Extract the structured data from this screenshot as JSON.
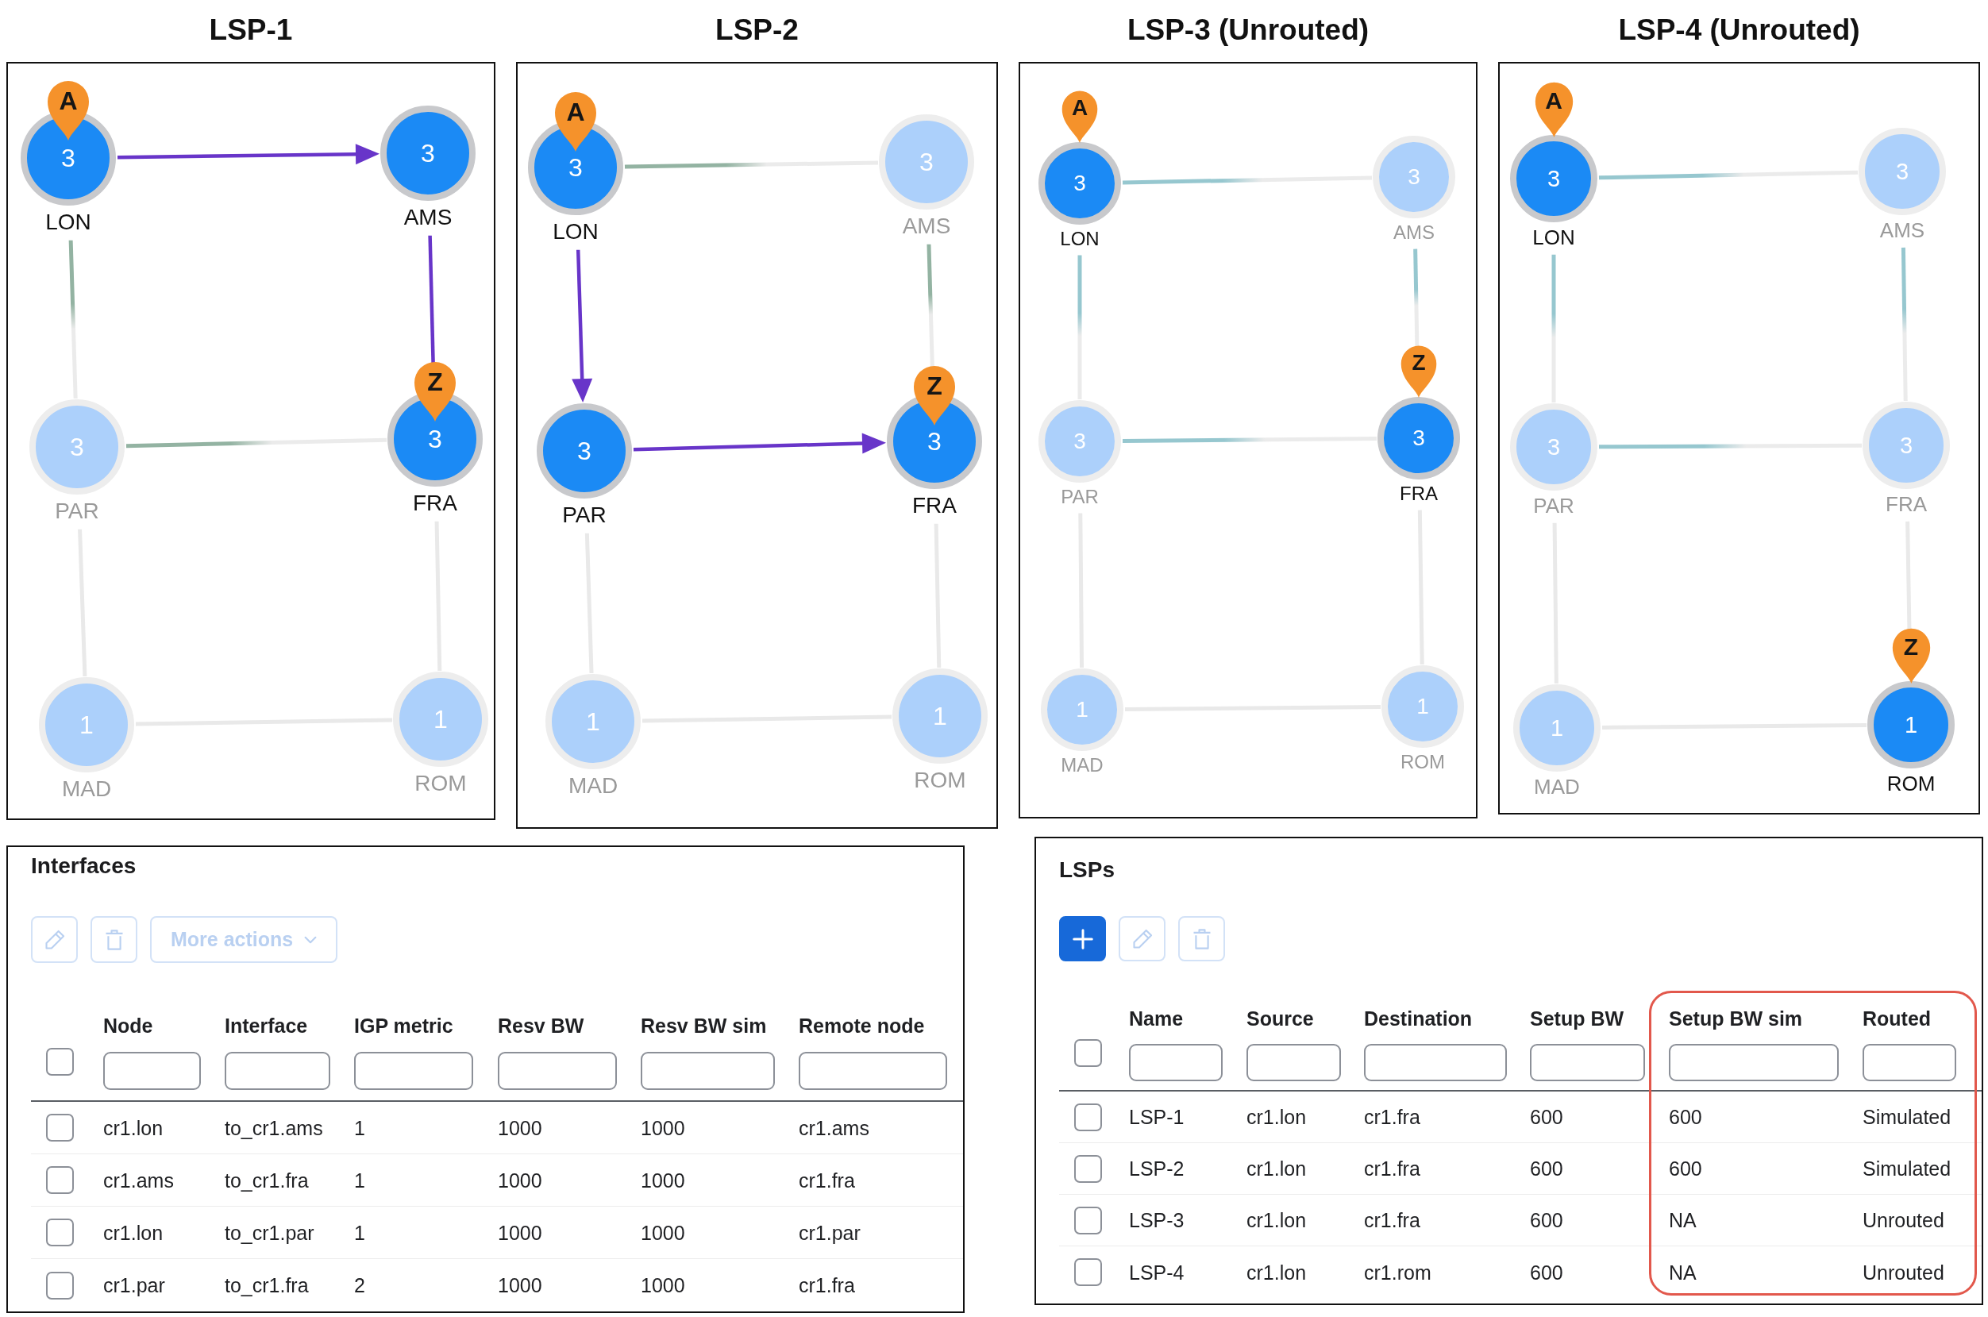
{
  "panels": [
    {
      "title": "LSP-1",
      "node_rows": [
        [
          {
            "label": "LON",
            "count": "3",
            "active": true,
            "pin": "A"
          },
          {
            "label": "AMS",
            "count": "3",
            "active": true
          }
        ],
        [
          {
            "label": "PAR",
            "count": "3",
            "active": false
          },
          {
            "label": "FRA",
            "count": "3",
            "active": true,
            "pin": "Z"
          }
        ],
        [
          {
            "label": "MAD",
            "count": "1",
            "active": false
          },
          {
            "label": "ROM",
            "count": "1",
            "active": false
          }
        ]
      ],
      "links": [
        {
          "kind": "path"
        },
        {
          "kind": "gradient",
          "color": "#93b3a2"
        },
        {
          "kind": "path"
        },
        {
          "kind": "gradient",
          "color": "#93b3a2"
        },
        {
          "kind": "plain"
        },
        {
          "kind": "plain"
        },
        {
          "kind": "plain"
        }
      ]
    },
    {
      "title": "LSP-2",
      "node_rows": [
        [
          {
            "label": "LON",
            "count": "3",
            "active": true,
            "pin": "A"
          },
          {
            "label": "AMS",
            "count": "3",
            "active": false
          }
        ],
        [
          {
            "label": "PAR",
            "count": "3",
            "active": true
          },
          {
            "label": "FRA",
            "count": "3",
            "active": true,
            "pin": "Z"
          }
        ],
        [
          {
            "label": "MAD",
            "count": "1",
            "active": false
          },
          {
            "label": "ROM",
            "count": "1",
            "active": false
          }
        ]
      ],
      "links": [
        {
          "kind": "gradient",
          "color": "#93b3a2"
        },
        {
          "kind": "path"
        },
        {
          "kind": "gradient",
          "color": "#93b3a2"
        },
        {
          "kind": "path"
        },
        {
          "kind": "plain"
        },
        {
          "kind": "plain"
        },
        {
          "kind": "plain"
        }
      ]
    },
    {
      "title": "LSP-3 (Unrouted)",
      "node_rows": [
        [
          {
            "label": "LON",
            "count": "3",
            "active": true,
            "pin": "A"
          },
          {
            "label": "AMS",
            "count": "3",
            "active": false
          }
        ],
        [
          {
            "label": "PAR",
            "count": "3",
            "active": false
          },
          {
            "label": "FRA",
            "count": "3",
            "active": true,
            "pin": "Z"
          }
        ],
        [
          {
            "label": "MAD",
            "count": "1",
            "active": false
          },
          {
            "label": "ROM",
            "count": "1",
            "active": false
          }
        ]
      ],
      "links": [
        {
          "kind": "gradient",
          "color": "#96c7cf"
        },
        {
          "kind": "gradient",
          "color": "#96c7cf"
        },
        {
          "kind": "gradient",
          "color": "#96c7cf"
        },
        {
          "kind": "gradient",
          "color": "#96c7cf"
        },
        {
          "kind": "plain"
        },
        {
          "kind": "plain"
        },
        {
          "kind": "plain"
        }
      ]
    },
    {
      "title": "LSP-4 (Unrouted)",
      "node_rows": [
        [
          {
            "label": "LON",
            "count": "3",
            "active": true,
            "pin": "A"
          },
          {
            "label": "AMS",
            "count": "3",
            "active": false
          }
        ],
        [
          {
            "label": "PAR",
            "count": "3",
            "active": false
          },
          {
            "label": "FRA",
            "count": "3",
            "active": false
          }
        ],
        [
          {
            "label": "MAD",
            "count": "1",
            "active": false
          },
          {
            "label": "ROM",
            "count": "1",
            "active": true,
            "pin": "Z"
          }
        ]
      ],
      "links": [
        {
          "kind": "gradient",
          "color": "#96c7cf"
        },
        {
          "kind": "gradient",
          "color": "#96c7cf"
        },
        {
          "kind": "gradient",
          "color": "#96c7cf"
        },
        {
          "kind": "gradient",
          "color": "#96c7cf"
        },
        {
          "kind": "plain"
        },
        {
          "kind": "plain"
        },
        {
          "kind": "plain"
        }
      ]
    }
  ],
  "tables": [
    {
      "title": "Interfaces",
      "toolbar": [
        {
          "kind": "edit",
          "disabled": true
        },
        {
          "kind": "delete",
          "disabled": true
        },
        {
          "kind": "menu",
          "label": "More actions",
          "disabled": true
        }
      ],
      "select_all": {
        "checked": false
      },
      "columns": [
        {
          "label": "Node"
        },
        {
          "label": "Interface"
        },
        {
          "label": "IGP metric"
        },
        {
          "label": "Resv BW"
        },
        {
          "label": "Resv BW sim"
        },
        {
          "label": "Remote node"
        }
      ],
      "rows": [
        {
          "checked": false,
          "cells": [
            "cr1.lon",
            "to_cr1.ams",
            "1",
            "1000",
            "1000",
            "cr1.ams"
          ]
        },
        {
          "checked": false,
          "cells": [
            "cr1.ams",
            "to_cr1.fra",
            "1",
            "1000",
            "1000",
            "cr1.fra"
          ]
        },
        {
          "checked": false,
          "cells": [
            "cr1.lon",
            "to_cr1.par",
            "1",
            "1000",
            "1000",
            "cr1.par"
          ]
        },
        {
          "checked": false,
          "cells": [
            "cr1.par",
            "to_cr1.fra",
            "2",
            "1000",
            "1000",
            "cr1.fra"
          ]
        }
      ]
    },
    {
      "title": "LSPs",
      "toolbar": [
        {
          "kind": "add",
          "disabled": false
        },
        {
          "kind": "edit",
          "disabled": true
        },
        {
          "kind": "delete",
          "disabled": true
        }
      ],
      "select_all": {
        "checked": false
      },
      "columns": [
        {
          "label": "Name",
          "highlighted": false
        },
        {
          "label": "Source",
          "highlighted": false
        },
        {
          "label": "Destination",
          "highlighted": false
        },
        {
          "label": "Setup BW",
          "highlighted": false
        },
        {
          "label": "Setup BW sim",
          "highlighted": true
        },
        {
          "label": "Routed",
          "highlighted": true
        }
      ],
      "rows": [
        {
          "checked": false,
          "cells": [
            "LSP-1",
            "cr1.lon",
            "cr1.fra",
            "600",
            "600",
            "Simulated"
          ]
        },
        {
          "checked": false,
          "cells": [
            "LSP-2",
            "cr1.lon",
            "cr1.fra",
            "600",
            "600",
            "Simulated"
          ]
        },
        {
          "checked": false,
          "cells": [
            "LSP-3",
            "cr1.lon",
            "cr1.fra",
            "600",
            "NA",
            "Unrouted"
          ]
        },
        {
          "checked": false,
          "cells": [
            "LSP-4",
            "cr1.lon",
            "cr1.rom",
            "600",
            "NA",
            "Unrouted"
          ]
        }
      ]
    }
  ]
}
